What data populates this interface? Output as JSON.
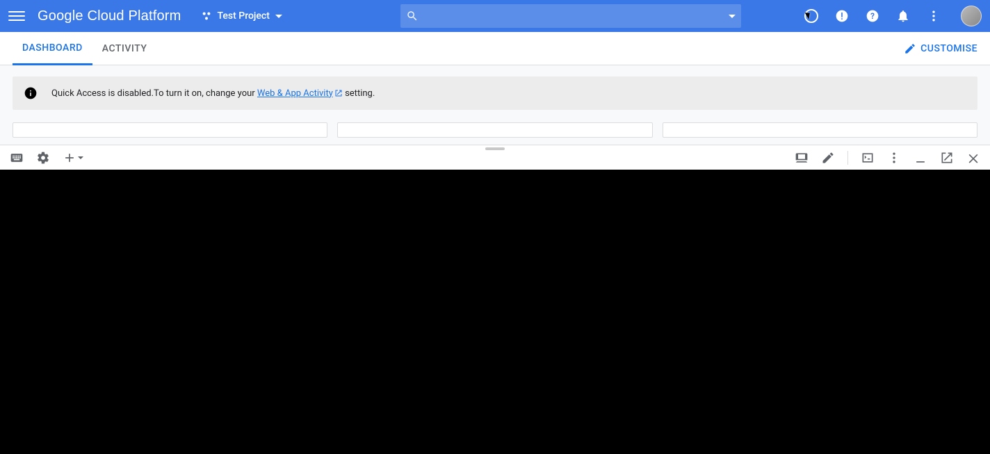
{
  "header": {
    "product_name": "Google Cloud Platform",
    "project_name": "Test Project",
    "search_placeholder": ""
  },
  "tabs": {
    "dashboard": "DASHBOARD",
    "activity": "ACTIVITY",
    "customise": "CUSTOMISE"
  },
  "banner": {
    "text_before": "Quick Access is disabled.To turn it on, change your ",
    "link_text": "Web & App Activity",
    "text_after": " setting."
  }
}
